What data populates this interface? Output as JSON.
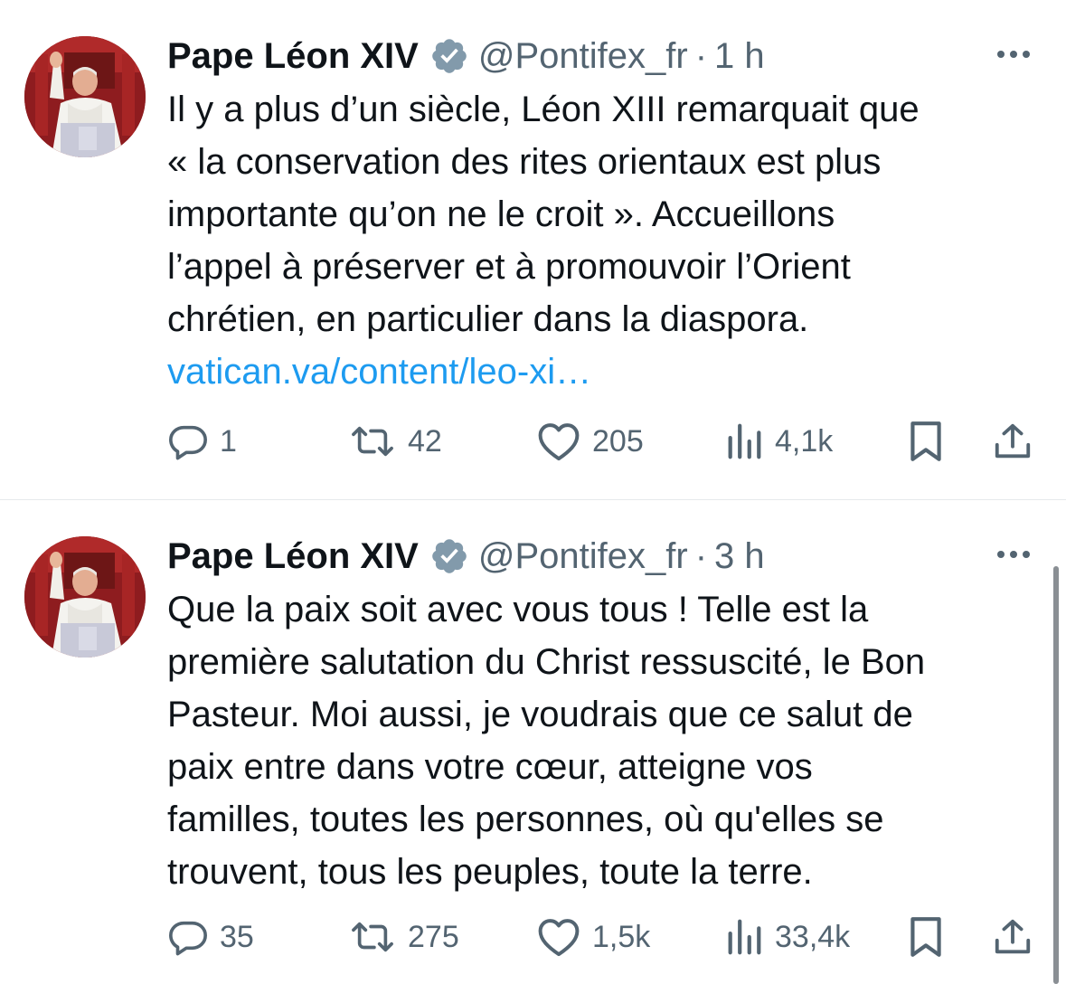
{
  "tweets": [
    {
      "display_name": "Pape Léon XIV",
      "handle": "@Pontifex_fr",
      "separator": "·",
      "time": "1 h",
      "text_lines": [
        "Il y a plus d’un siècle, Léon XIII remarquait que",
        "« la conservation des rites orientaux est plus",
        "importante qu’on ne le croit ». Accueillons",
        "l’appel à préserver et à promouvoir l’Orient",
        "chrétien, en particulier dans la diaspora."
      ],
      "link": "vatican.va/content/leo-xi…",
      "replies": "1",
      "reposts": "42",
      "likes": "205",
      "views": "4,1k"
    },
    {
      "display_name": "Pape Léon XIV",
      "handle": "@Pontifex_fr",
      "separator": "·",
      "time": "3 h",
      "text_lines": [
        "Que la paix soit avec vous tous ! Telle est la",
        "première salutation du Christ ressuscité, le Bon",
        "Pasteur. Moi aussi, je voudrais que ce salut de",
        "paix entre dans votre cœur, atteigne vos",
        "familles, toutes les personnes, où qu'elles se",
        "trouvent, tous les peuples, toute la terre."
      ],
      "replies": "35",
      "reposts": "275",
      "likes": "1,5k",
      "views": "33,4k"
    }
  ],
  "icons": {
    "reply": "reply-icon",
    "repost": "repost-icon",
    "like": "heart-icon",
    "views": "views-icon",
    "bookmark": "bookmark-icon",
    "share": "share-icon",
    "more": "more-icon",
    "verified": "verified-badge-icon"
  },
  "colors": {
    "text": "#0f1419",
    "secondary": "#536471",
    "link": "#1d9bf0",
    "verified_badge": "#829aab",
    "divider": "#e6e9ec"
  }
}
